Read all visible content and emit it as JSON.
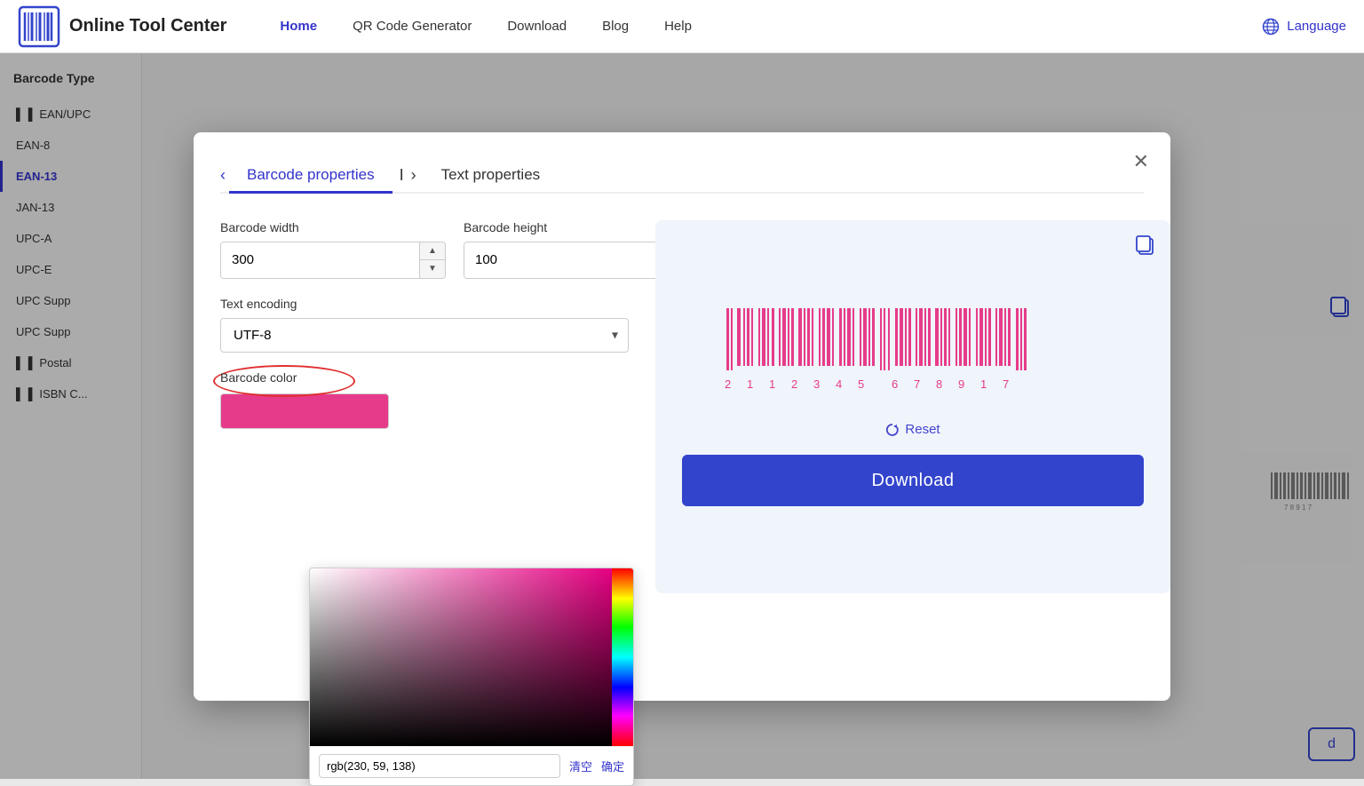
{
  "navbar": {
    "logo_text": "Online Tool Center",
    "links": [
      {
        "id": "home",
        "label": "Home",
        "active": true
      },
      {
        "id": "qr",
        "label": "QR Code Generator",
        "active": false
      },
      {
        "id": "download",
        "label": "Download",
        "active": false
      },
      {
        "id": "blog",
        "label": "Blog",
        "active": false
      },
      {
        "id": "help",
        "label": "Help",
        "active": false
      }
    ],
    "language_label": "Language"
  },
  "sidebar": {
    "title": "Barcode Type",
    "items": [
      {
        "id": "ean-upc",
        "label": "EAN/UPC",
        "icon": "▌▐",
        "active": false
      },
      {
        "id": "ean-8",
        "label": "EAN-8",
        "icon": "",
        "active": false
      },
      {
        "id": "ean-13",
        "label": "EAN-13",
        "icon": "",
        "active": true
      },
      {
        "id": "jan-13",
        "label": "JAN-13",
        "icon": "",
        "active": false
      },
      {
        "id": "upc-a",
        "label": "UPC-A",
        "icon": "",
        "active": false
      },
      {
        "id": "upc-e",
        "label": "UPC-E",
        "icon": "",
        "active": false
      },
      {
        "id": "upc-supp1",
        "label": "UPC Supp",
        "icon": "",
        "active": false
      },
      {
        "id": "upc-supp2",
        "label": "UPC Supp",
        "icon": "",
        "active": false
      },
      {
        "id": "postal",
        "label": "Postal",
        "icon": "▌▐",
        "active": false
      },
      {
        "id": "isbn",
        "label": "ISBN C...",
        "icon": "▌▐",
        "active": false
      }
    ]
  },
  "modal": {
    "tabs": [
      {
        "id": "barcode-props",
        "label": "Barcode properties",
        "active": true
      },
      {
        "id": "text-props",
        "label": "Text properties",
        "active": false
      }
    ],
    "fields": {
      "barcode_width_label": "Barcode width",
      "barcode_width_value": "300",
      "barcode_height_label": "Barcode height",
      "barcode_height_value": "100",
      "text_encoding_label": "Text encoding",
      "text_encoding_value": "UTF-8",
      "barcode_color_label": "Barcode color"
    },
    "color_picker": {
      "color_value": "rgb(230, 59, 138)",
      "clear_btn": "清空",
      "confirm_btn": "确定"
    },
    "reset_label": "Reset",
    "download_label": "Download",
    "barcode_digits": "2  1  1  2  3  4  5    6  7  8  9  1  7"
  }
}
